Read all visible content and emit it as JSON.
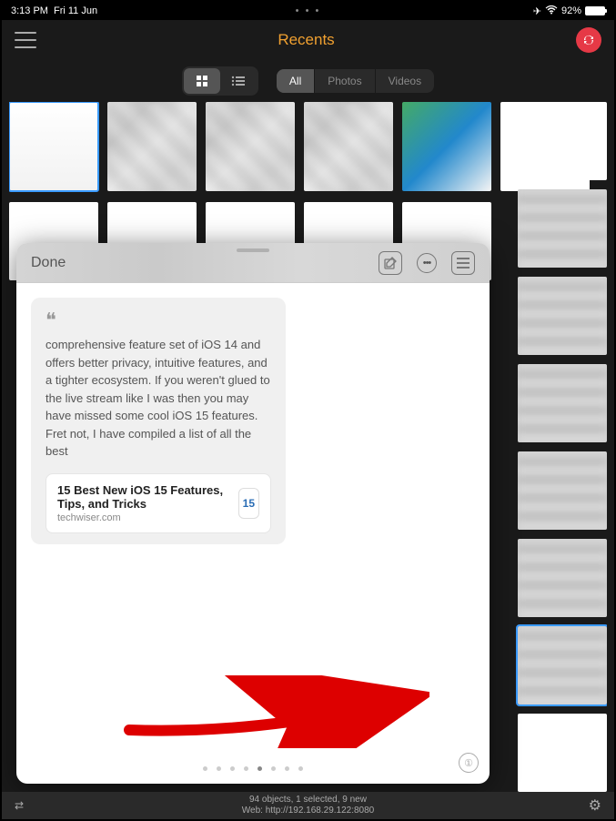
{
  "status": {
    "time": "3:13 PM",
    "date": "Fri 11 Jun",
    "dots": "• • •",
    "airplane": "✈",
    "rssi": "▾",
    "battery_pct": "92%"
  },
  "nav": {
    "title": "Recents"
  },
  "filters": {
    "all": "All",
    "photos": "Photos",
    "videos": "Videos"
  },
  "sheet": {
    "done": "Done",
    "quote_glyph": "❝",
    "note_text": "comprehensive feature set of iOS 14 and offers better privacy, intuitive features, and a tighter ecosystem. If you weren't glued to the live stream like I was then you may have missed some cool iOS 15 features. Fret not, I have compiled a list of all the best",
    "link_title": "15 Best New iOS 15 Features, Tips, and Tricks",
    "link_source": "techwiser.com",
    "link_badge": "15",
    "corner_glyph": "①"
  },
  "bottom": {
    "line1": "94 objects, 1 selected, 9 new",
    "line2": "Web: http://192.168.29.122:8080"
  }
}
